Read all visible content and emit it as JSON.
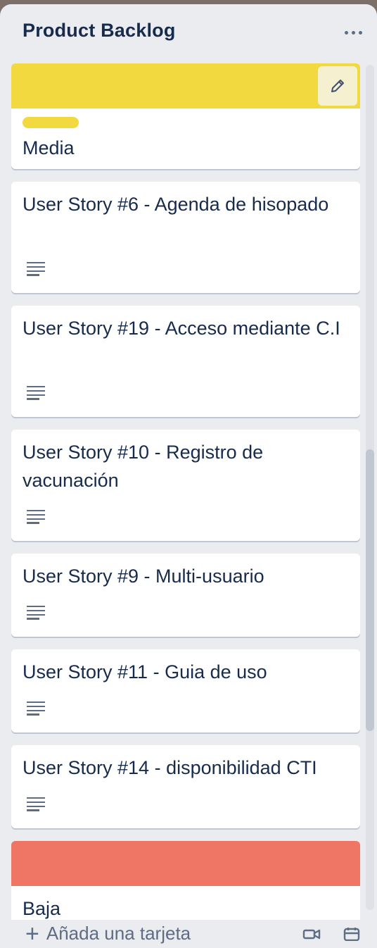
{
  "list": {
    "title": "Product Backlog",
    "menu_icon": "more-horizontal-icon"
  },
  "cards": [
    {
      "cover_color": "#f2d93f",
      "label_color": "#f2d93f",
      "title": "Media"
    },
    {
      "title": "User Story #6 - Agenda de hisopado",
      "has_description": true
    },
    {
      "title": "User Story #19 - Acceso mediante C.I",
      "has_description": true
    },
    {
      "title": "User Story #10 - Registro de vacunación",
      "has_description": true
    },
    {
      "title": "User Story #9 - Multi-usuario",
      "has_description": true
    },
    {
      "title": "User Story #11 - Guia de uso",
      "has_description": true
    },
    {
      "title": "User Story #14 - disponibilidad CTI",
      "has_description": true
    },
    {
      "cover_color": "#ef7564",
      "title": "Baja"
    }
  ],
  "footer": {
    "add_card_label": "Añada una tarjeta",
    "add_icon": "plus-icon",
    "video_icon": "video-icon",
    "template_icon": "card-template-icon"
  },
  "colors": {
    "list_bg": "#ebecf0",
    "card_bg": "#ffffff",
    "text": "#172b4d",
    "muted": "#5e6c84"
  }
}
